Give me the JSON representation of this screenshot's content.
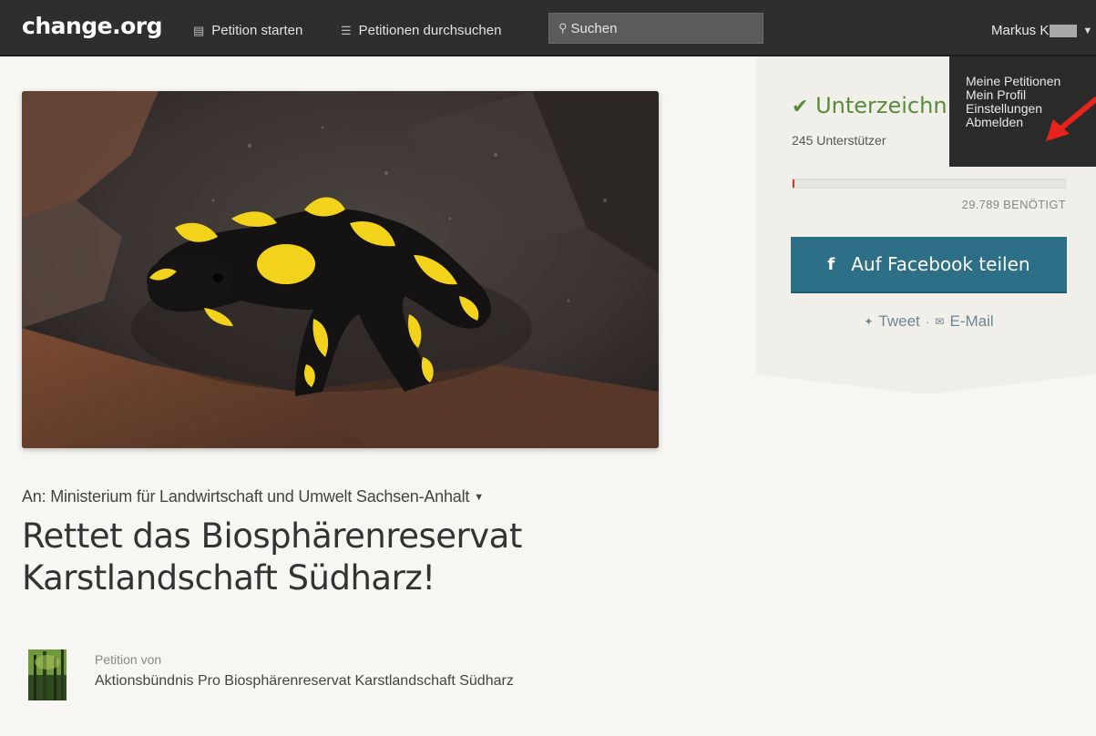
{
  "header": {
    "logo": "change.org",
    "nav": [
      {
        "icon": "document-icon",
        "label": "Petition starten"
      },
      {
        "icon": "list-icon",
        "label": "Petitionen durchsuchen"
      }
    ],
    "search": {
      "placeholder": "Suchen"
    },
    "user_name": "Markus K"
  },
  "user_menu": {
    "items": [
      "Meine Petitionen",
      "Mein Profil",
      "Einstellungen",
      "Abmelden"
    ]
  },
  "petition": {
    "to": "An: Ministerium für Landwirtschaft und Umwelt Sachsen-Anhalt",
    "title": "Rettet das Biosphärenreservat Karstlandschaft Südharz!",
    "creator_label": "Petition von",
    "creator_name": "Aktionsbündnis Pro Biosphärenreservat Karstlandschaft Südharz"
  },
  "sidebar": {
    "signed_label": "Unterzeichnet",
    "supporters": "245 Unterstützer",
    "progress_fraction": 0.008,
    "needed": "29.789 BENÖTIGT",
    "facebook_button": "Auf Facebook teilen",
    "tweet_label": "Tweet",
    "separator": "·",
    "email_label": "E-Mail"
  },
  "colors": {
    "topbar": "#2e2e2e",
    "signed_green": "#5a8b3c",
    "facebook_button": "#2d6f86",
    "progress_fill": "#cc3a2b",
    "annotation_arrow": "#e8231b"
  }
}
